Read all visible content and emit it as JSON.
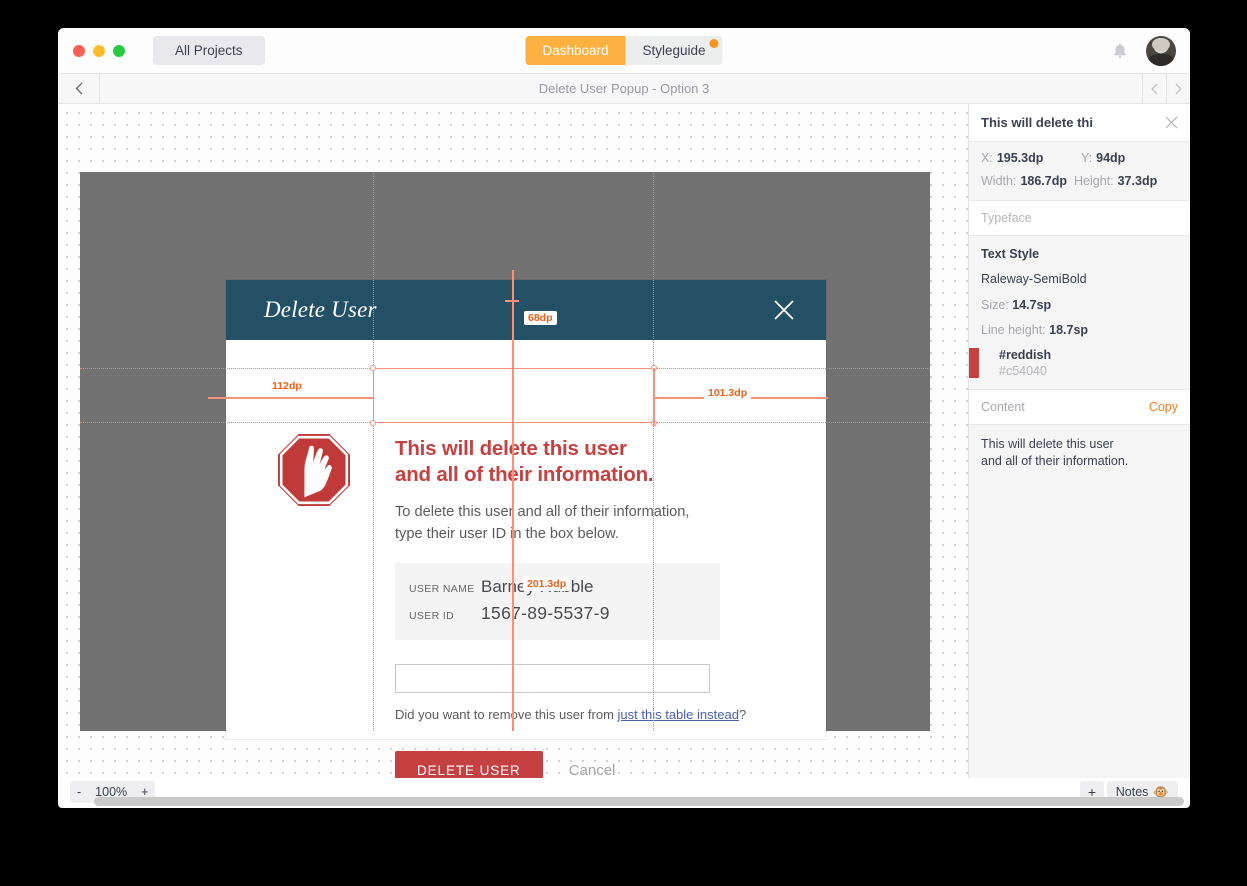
{
  "titlebar": {
    "all_projects_label": "All Projects",
    "tabs": [
      {
        "label": "Dashboard",
        "active": true,
        "badge": false
      },
      {
        "label": "Styleguide",
        "active": false,
        "badge": true
      }
    ],
    "bell_icon": "bell-icon",
    "avatar_icon": "user-avatar"
  },
  "docbar": {
    "back_icon": "chevron-left-icon",
    "title": "Delete User Popup - Option 3",
    "prev_icon": "chevron-left-icon",
    "next_icon": "chevron-right-icon"
  },
  "dialog": {
    "title": "Delete User",
    "close_icon": "close-icon",
    "stop_icon": "stop-sign-icon",
    "alert_line1": "This will delete this user",
    "alert_line2": "and all of their information.",
    "sub_line1": "To delete this user and all of their information,",
    "sub_line2": "type their user ID in the box below.",
    "info": [
      {
        "label": "USER NAME",
        "value": "Barney Rubble"
      },
      {
        "label": "USER ID",
        "value": "1567-89-5537-9"
      }
    ],
    "input_value": "",
    "input_placeholder": "",
    "helper_prefix": "Did you want to remove this user from ",
    "helper_link": "just this table instead",
    "helper_suffix": "?",
    "delete_label": "DELETE USER",
    "cancel_label": "Cancel"
  },
  "measurements": {
    "top_gap": "68dp",
    "left_gap": "112dp",
    "right_gap": "101.3dp",
    "bottom_gap": "201.3dp"
  },
  "bottombar": {
    "zoom_out": "-",
    "zoom_level": "100%",
    "zoom_in": "+",
    "add_label": "+",
    "notes_label": "Notes",
    "notes_emoji": "🐵"
  },
  "panel": {
    "header_title": "This will delete thi",
    "close_icon": "close-icon",
    "geometry": [
      {
        "key": "X:",
        "value": "195.3dp"
      },
      {
        "key": "Y:",
        "value": "94dp"
      },
      {
        "key": "Width:",
        "value": "186.7dp"
      },
      {
        "key": "Height:",
        "value": "37.3dp"
      }
    ],
    "typeface_label": "Typeface",
    "text_style_label": "Text Style",
    "font_name": "Raleway-SemiBold",
    "size_key": "Size:",
    "size_value": "14.7sp",
    "line_height_key": "Line height:",
    "line_height_value": "18.7sp",
    "color_name": "#reddish",
    "color_hex": "#c54040",
    "content_label": "Content",
    "copy_label": "Copy",
    "content_line1": "This will delete this user",
    "content_line2": "and all of their information."
  },
  "colors": {
    "accent_orange": "#fcb040",
    "dialog_header": "#245066",
    "alert_red": "#c54040",
    "measure": "#f7917a",
    "measure_label": "#e8601c",
    "copy_orange": "#f07c1e"
  }
}
